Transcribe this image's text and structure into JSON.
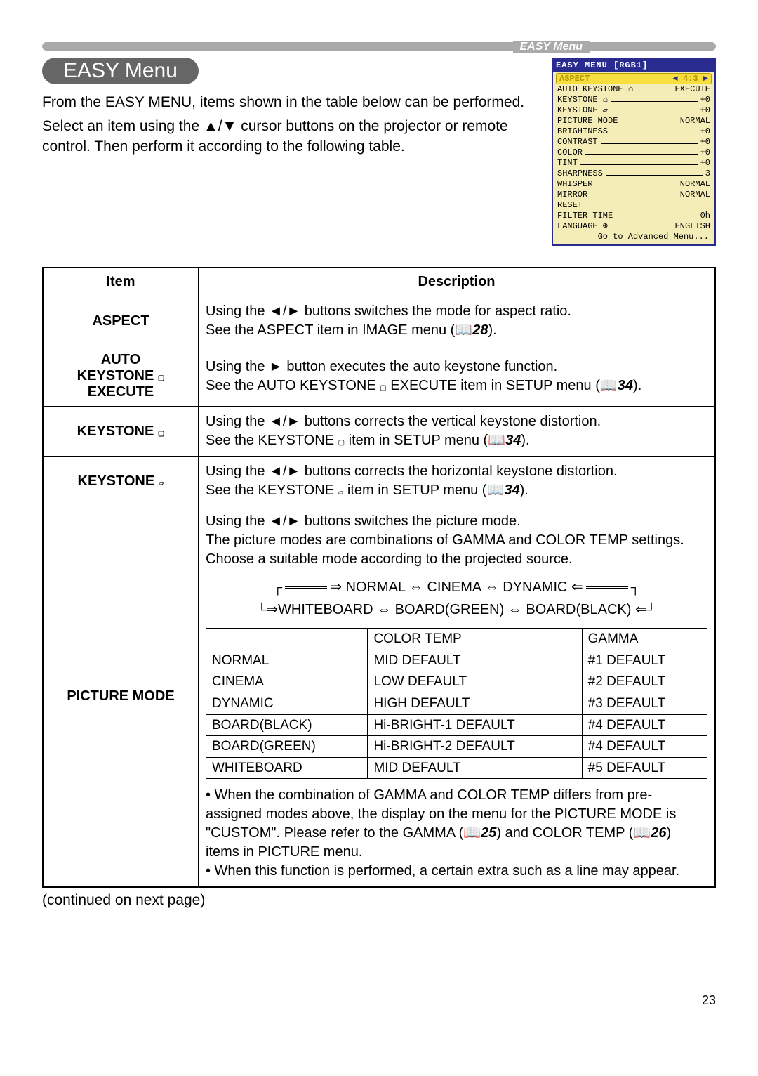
{
  "header": {
    "tab": "EASY Menu",
    "title": "EASY Menu",
    "intro1": "From the EASY MENU, items shown in the table below can be performed.",
    "intro2": "Select an item using the ▲/▼ cursor buttons on the projector or remote control. Then perform it according to the following table."
  },
  "osd": {
    "title": "EASY MENU [RGB1]",
    "aspect_label": "ASPECT",
    "aspect_value": "4:3",
    "rows": [
      {
        "label": "AUTO KEYSTONE",
        "icon": "⌂",
        "value": "EXECUTE"
      },
      {
        "label": "KEYSTONE",
        "icon": "⌂",
        "bar": true,
        "value": "+0"
      },
      {
        "label": "KEYSTONE",
        "icon": "▱",
        "bar": true,
        "value": "+0"
      },
      {
        "label": "PICTURE MODE",
        "value": "NORMAL"
      },
      {
        "label": "BRIGHTNESS",
        "bar": true,
        "value": "+0"
      },
      {
        "label": "CONTRAST",
        "bar": true,
        "value": "+0"
      },
      {
        "label": "COLOR",
        "bar": true,
        "value": "+0"
      },
      {
        "label": "TINT",
        "bar": true,
        "value": "+0"
      },
      {
        "label": "SHARPNESS",
        "bar": true,
        "value": "3"
      },
      {
        "label": "WHISPER",
        "value": "NORMAL"
      },
      {
        "label": "MIRROR",
        "value": "NORMAL"
      },
      {
        "label": "RESET",
        "value": ""
      },
      {
        "label": "FILTER TIME",
        "value": "0h"
      },
      {
        "label": "LANGUAGE",
        "icon": "⊛",
        "value": "ENGLISH"
      }
    ],
    "footer": "Go to Advanced Menu..."
  },
  "table": {
    "h_item": "Item",
    "h_desc": "Description",
    "r1_item": "ASPECT",
    "r1_d1": "Using the ◄/► buttons switches the mode for aspect ratio.",
    "r1_d2a": "See the ASPECT item in IMAGE menu (",
    "r1_d2b": "28",
    "r1_d2c": ").",
    "r2_item1": "AUTO",
    "r2_item2": "KEYSTONE ",
    "r2_item3": "EXECUTE",
    "r2_d1": "Using the ► button executes the auto keystone function.",
    "r2_d2a": "See the AUTO KEYSTONE ",
    "r2_d2b": " EXECUTE item in SETUP menu (",
    "r2_d2c": "34",
    "r2_d2d": ").",
    "r3_item": "KEYSTONE ",
    "r3_d1": "Using the ◄/► buttons corrects the vertical keystone distortion.",
    "r3_d2a": "See the KEYSTONE ",
    "r3_d2b": " item in SETUP menu (",
    "r3_d2c": "34",
    "r3_d2d": ").",
    "r4_item": "KEYSTONE ",
    "r4_d1": "Using the ◄/► buttons corrects the horizontal keystone distortion.",
    "r4_d2a": "See the KEYSTONE ",
    "r4_d2b": " item in SETUP menu (",
    "r4_d2c": "34",
    "r4_d2d": ").",
    "r5_item": "PICTURE MODE",
    "r5_p1": "Using the ◄/► buttons switches the picture mode.",
    "r5_p2": "The picture modes are combinations of GAMMA and COLOR TEMP settings. Choose a suitable mode according to the projected source.",
    "r5_flow1": "NORMAL ⇔ CINEMA ⇔ DYNAMIC",
    "r5_flow2": "WHITEBOARD ⇔ BOARD(GREEN) ⇔ BOARD(BLACK)",
    "r5_note1": "• When the combination of GAMMA and COLOR TEMP differs from pre-assigned modes above, the display on the menu for the PICTURE MODE is \"CUSTOM\". Please refer to the GAMMA (",
    "r5_note1b": "25",
    "r5_note1c": ") and COLOR TEMP (",
    "r5_note1d": "26",
    "r5_note1e": ") items in PICTURE menu.",
    "r5_note2": "• When this function is performed, a certain extra such as a line may appear.",
    "sub": {
      "h_empty": "",
      "h_ct": "COLOR TEMP",
      "h_g": "GAMMA",
      "rows": [
        {
          "m": "NORMAL",
          "ct": "MID DEFAULT",
          "g": "#1 DEFAULT"
        },
        {
          "m": "CINEMA",
          "ct": "LOW DEFAULT",
          "g": "#2 DEFAULT"
        },
        {
          "m": "DYNAMIC",
          "ct": "HIGH DEFAULT",
          "g": "#3 DEFAULT"
        },
        {
          "m": "BOARD(BLACK)",
          "ct": "Hi-BRIGHT-1 DEFAULT",
          "g": "#4 DEFAULT"
        },
        {
          "m": "BOARD(GREEN)",
          "ct": "Hi-BRIGHT-2 DEFAULT",
          "g": "#4 DEFAULT"
        },
        {
          "m": "WHITEBOARD",
          "ct": "MID DEFAULT",
          "g": "#5 DEFAULT"
        }
      ]
    }
  },
  "continued": "(continued on next page)",
  "pagenum": "23",
  "icons": {
    "trap_v": "⌂",
    "trap_h": "▱",
    "book": "📖"
  }
}
